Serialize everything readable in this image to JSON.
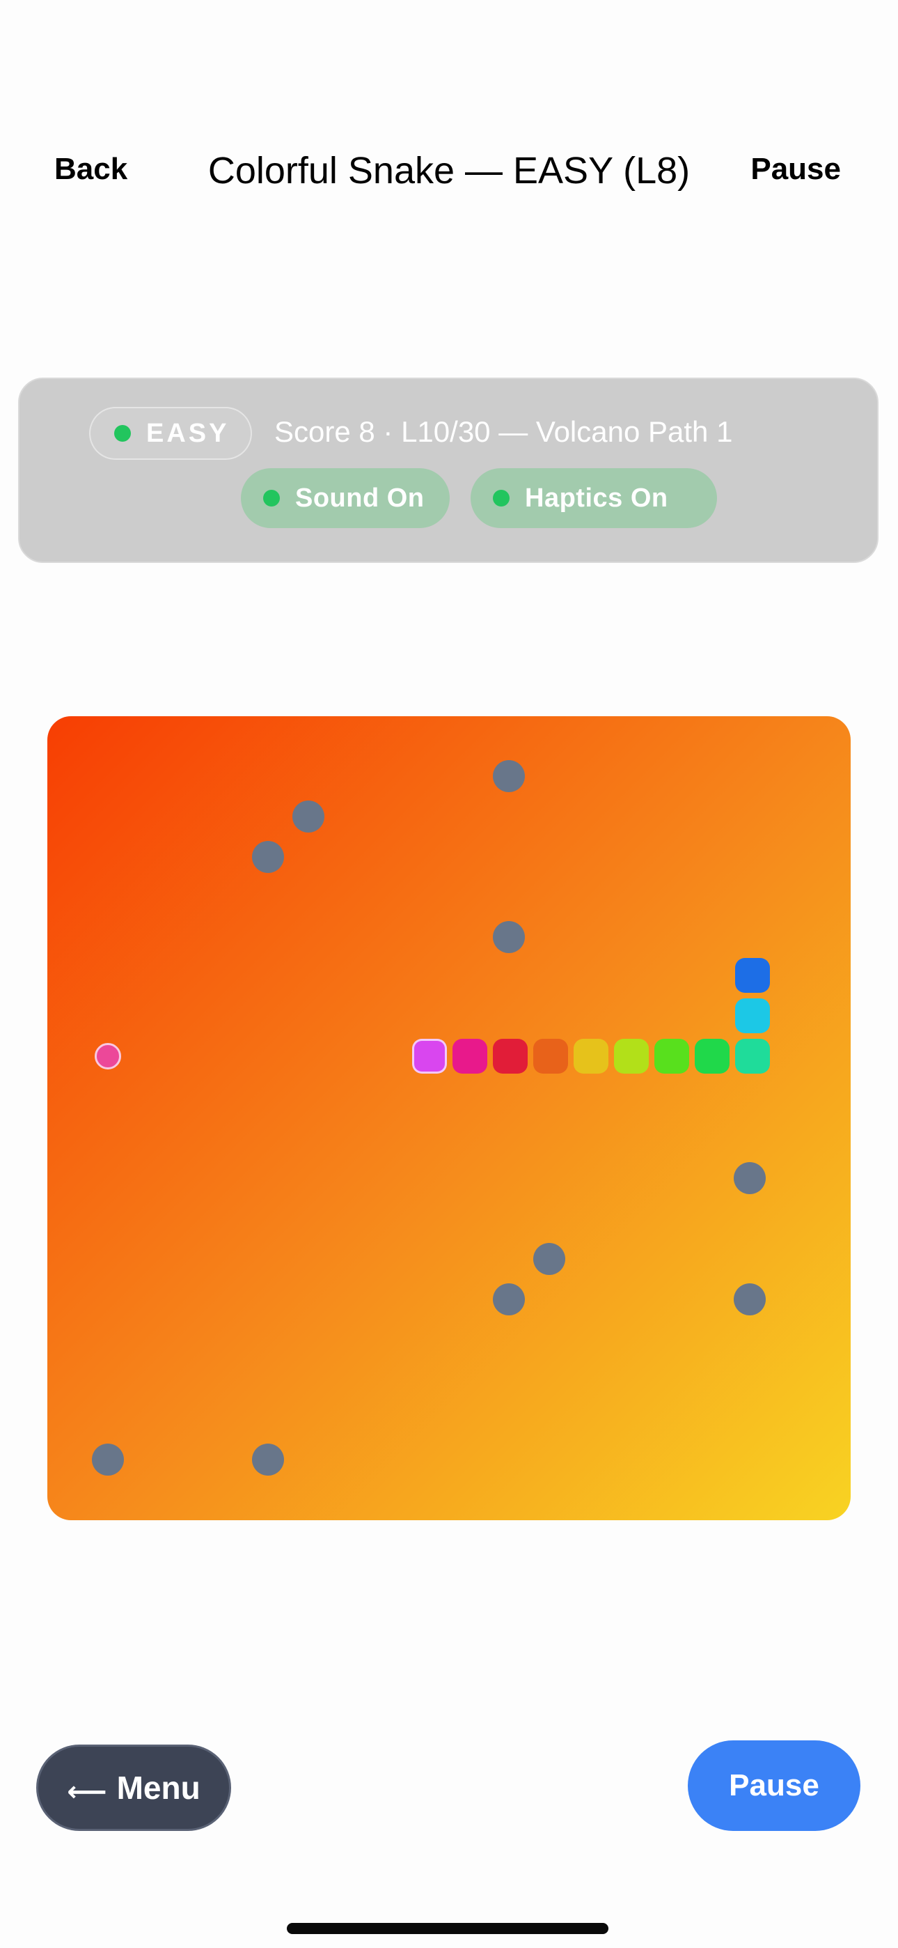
{
  "nav": {
    "back_label": "Back",
    "title": "Colorful Snake — EASY (L8)",
    "pause_label": "Pause"
  },
  "hud": {
    "difficulty_badge": "EASY",
    "status_text": "Score 8 · L10/30 — Volcano Path 1",
    "sound_toggle": "Sound On",
    "haptics_toggle": "Haptics On"
  },
  "board": {
    "theme_colors": [
      "#f73e03",
      "#f6861b",
      "#f8d322"
    ],
    "obstacle_color": "#68768a",
    "food_color": "#ec4899",
    "snake_colors": [
      "#d946ef",
      "#e8198b",
      "#e11d38",
      "#e8621a",
      "#e6c21b",
      "#b2e019",
      "#58e01d",
      "#20d84a",
      "#1fdc9a",
      "#1cc8e6",
      "#1d6ee6"
    ]
  },
  "controls": {
    "menu_label": "Menu",
    "pause_label": "Pause"
  }
}
